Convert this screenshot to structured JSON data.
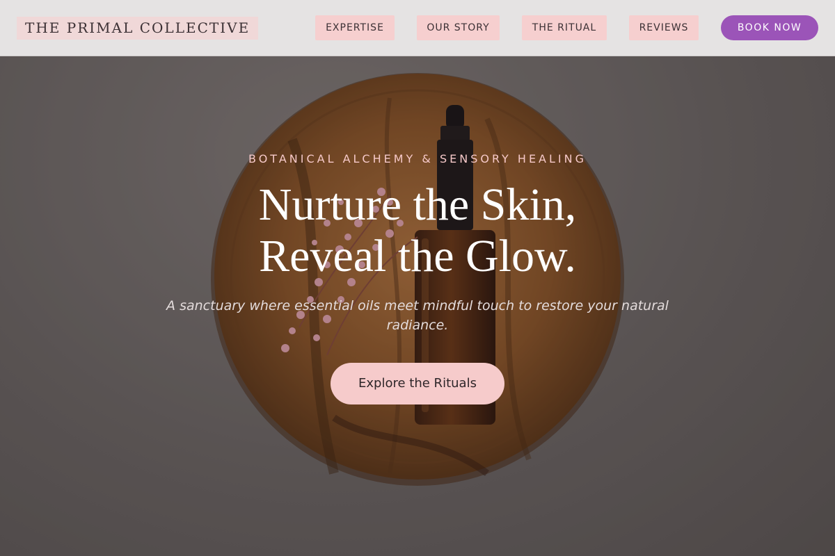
{
  "header": {
    "brand": "THE PRIMAL COLLECTIVE",
    "nav": [
      "EXPERTISE",
      "OUR STORY",
      "THE RITUAL",
      "REVIEWS"
    ],
    "cta": "BOOK NOW"
  },
  "hero": {
    "kicker": "BOTANICAL ALCHEMY & SENSORY HEALING",
    "headline_line1": "Nurture the Skin,",
    "headline_line2": "Reveal the Glow.",
    "subcopy": "A sanctuary where essential oils meet mindful touch to restore your natural radiance.",
    "cta": "Explore the Rituals"
  },
  "colors": {
    "accent_purple": "#9b54b8",
    "accent_pink": "#f6cbcb",
    "header_bg": "#e5e3e3"
  },
  "background": {
    "subjects": [
      "wooden-plate",
      "amber-dropper-bottle",
      "dried-pink-flowers"
    ]
  }
}
